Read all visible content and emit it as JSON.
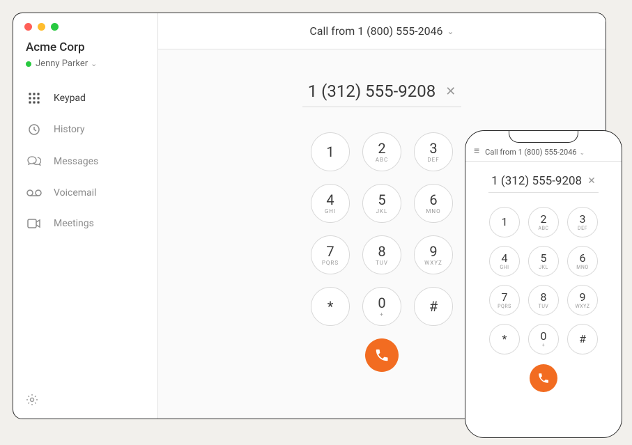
{
  "desktop": {
    "company": "Acme Corp",
    "user": "Jenny Parker",
    "header_prefix": "Call from",
    "header_number": "1 (800) 555-2046",
    "entered_number": "1 (312) 555-9208",
    "sidebar": [
      {
        "label": "Keypad"
      },
      {
        "label": "History"
      },
      {
        "label": "Messages"
      },
      {
        "label": "Voicemail"
      },
      {
        "label": "Meetings"
      }
    ],
    "keypad": [
      {
        "num": "1",
        "sub": ""
      },
      {
        "num": "2",
        "sub": "ABC"
      },
      {
        "num": "3",
        "sub": "DEF"
      },
      {
        "num": "4",
        "sub": "GHI"
      },
      {
        "num": "5",
        "sub": "JKL"
      },
      {
        "num": "6",
        "sub": "MNO"
      },
      {
        "num": "7",
        "sub": "PQRS"
      },
      {
        "num": "8",
        "sub": "TUV"
      },
      {
        "num": "9",
        "sub": "WXYZ"
      },
      {
        "num": "*",
        "sub": ""
      },
      {
        "num": "0",
        "sub": "+"
      },
      {
        "num": "#",
        "sub": ""
      }
    ]
  },
  "mobile": {
    "header_prefix": "Call from",
    "header_number": "1 (800) 555-2046",
    "entered_number": "1 (312) 555-9208",
    "keypad": [
      {
        "num": "1",
        "sub": ""
      },
      {
        "num": "2",
        "sub": "ABC"
      },
      {
        "num": "3",
        "sub": "DEF"
      },
      {
        "num": "4",
        "sub": "GHI"
      },
      {
        "num": "5",
        "sub": "JKL"
      },
      {
        "num": "6",
        "sub": "MNO"
      },
      {
        "num": "7",
        "sub": "PQRS"
      },
      {
        "num": "8",
        "sub": "TUV"
      },
      {
        "num": "9",
        "sub": "WXYZ"
      },
      {
        "num": "*",
        "sub": ""
      },
      {
        "num": "0",
        "sub": "+"
      },
      {
        "num": "#",
        "sub": ""
      }
    ]
  },
  "colors": {
    "accent": "#f26c21",
    "presence": "#28c940"
  }
}
